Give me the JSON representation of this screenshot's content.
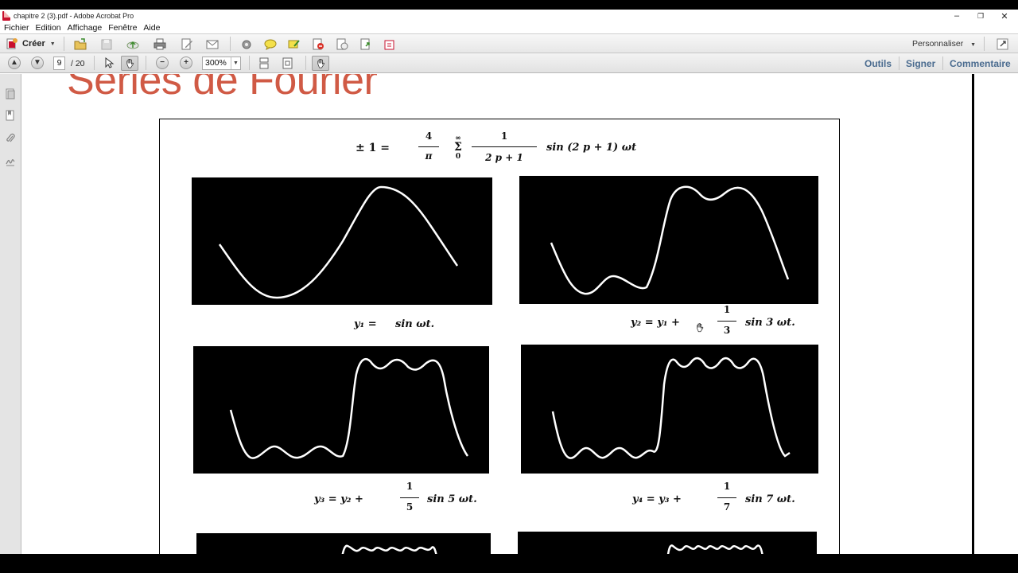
{
  "window": {
    "title": "chapitre 2 (3).pdf - Adobe Acrobat Pro",
    "minimize": "–",
    "restore": "❐",
    "close": "✕"
  },
  "menu": {
    "items": [
      "Fichier",
      "Edition",
      "Affichage",
      "Fenêtre",
      "Aide"
    ]
  },
  "toolbar": {
    "create_label": "Créer",
    "personnaliser_label": "Personnaliser"
  },
  "nav": {
    "page_current": "9",
    "page_total": "/ 20",
    "zoom": "300%",
    "links": [
      "Outils",
      "Signer",
      "Commentaire"
    ]
  },
  "document": {
    "slide_title": "Séries de Fourier",
    "formula": {
      "lhs": "± 1 =",
      "coef_num": "4",
      "coef_den": "π",
      "sum_top": "∞",
      "sum_sym": "Σ",
      "sum_bottom": "0",
      "term_num": "1",
      "term_den": "2 p + 1",
      "tail": "sin (2 p + 1) ωt"
    },
    "captions": {
      "y1": {
        "lhs": "y₁ =",
        "rhs": "sin ωt."
      },
      "y2": {
        "lhs": "y₂ = y₁ +",
        "num": "1",
        "den": "3",
        "rhs": "sin 3 ωt."
      },
      "y3": {
        "lhs": "y₃ = y₂ +",
        "num": "1",
        "den": "5",
        "rhs": "sin 5 ωt."
      },
      "y4": {
        "lhs": "y₄ = y₃ +",
        "num": "1",
        "den": "7",
        "rhs": "sin 7 ωt."
      }
    }
  }
}
